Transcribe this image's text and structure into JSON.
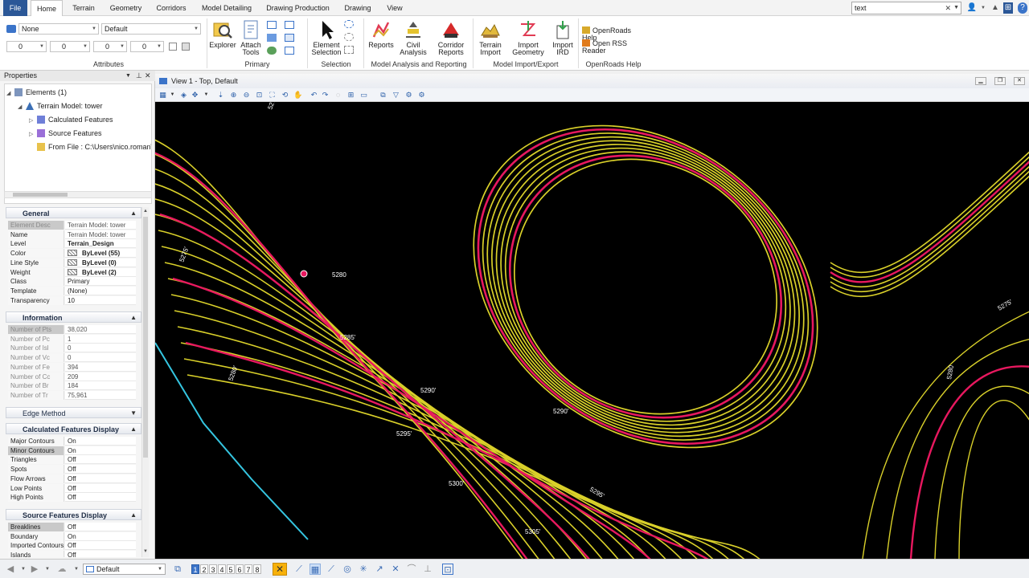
{
  "ribbon": {
    "tabs": [
      "File",
      "Home",
      "Terrain",
      "Geometry",
      "Corridors",
      "Model Detailing",
      "Drawing Production",
      "Drawing",
      "View"
    ],
    "active_tab": "Home",
    "search_value": "text",
    "attributes": {
      "level": "None",
      "style": "Default",
      "weight_a": "0",
      "weight_b": "0",
      "weight_c": "0",
      "weight_d": "0",
      "group_label": "Attributes"
    },
    "primary": {
      "explorer": "Explorer",
      "attach_tools": [
        "Attach",
        "Tools"
      ],
      "group_label": "Primary"
    },
    "selection": {
      "element_selection": [
        "Element",
        "Selection"
      ],
      "group_label": "Selection"
    },
    "analysis": {
      "reports": "Reports",
      "civil_analysis": [
        "Civil",
        "Analysis"
      ],
      "corridor_reports": [
        "Corridor",
        "Reports"
      ],
      "group_label": "Model Analysis and Reporting"
    },
    "import_export": {
      "terrain_import": [
        "Terrain",
        "Import"
      ],
      "import_geometry": [
        "Import",
        "Geometry"
      ],
      "import_ird": [
        "Import",
        "IRD"
      ],
      "group_label": "Model Import/Export"
    },
    "help": {
      "openroads_help": "OpenRoads Help",
      "rss": "Open RSS Reader",
      "group_label": "OpenRoads Help"
    }
  },
  "properties_panel": {
    "title": "Properties",
    "tree": {
      "elements": "Elements (1)",
      "terrain_model": "Terrain Model: tower",
      "calculated": "Calculated Features",
      "source": "Source Features",
      "from_file": "From File : C:\\Users\\nico.roman\\"
    },
    "sections": {
      "general": "General",
      "information": "Information",
      "edge_method": "Edge Method",
      "calc_display": "Calculated Features Display",
      "source_display": "Source Features Display"
    },
    "general_rows": [
      {
        "k": "Element Desc",
        "v": "Terrain Model: tower"
      },
      {
        "k": "Name",
        "v": "Terrain Model: tower"
      },
      {
        "k": "Level",
        "v": "Terrain_Design"
      },
      {
        "k": "Color",
        "v": "ByLevel (55)"
      },
      {
        "k": "Line Style",
        "v": "ByLevel (0)"
      },
      {
        "k": "Weight",
        "v": "ByLevel (2)"
      },
      {
        "k": "Class",
        "v": "Primary"
      },
      {
        "k": "Template",
        "v": "(None)"
      },
      {
        "k": "Transparency",
        "v": "10"
      }
    ],
    "information_rows": [
      {
        "k": "Number of Pts",
        "v": "38,020"
      },
      {
        "k": "Number of Pc",
        "v": "1"
      },
      {
        "k": "Number of Isl",
        "v": "0"
      },
      {
        "k": "Number of Vc",
        "v": "0"
      },
      {
        "k": "Number of Fe",
        "v": "394"
      },
      {
        "k": "Number of Cc",
        "v": "209"
      },
      {
        "k": "Number of Br",
        "v": "184"
      },
      {
        "k": "Number of Tr",
        "v": "75,961"
      }
    ],
    "calc_rows": [
      {
        "k": "Major Contours",
        "v": "On"
      },
      {
        "k": "Minor Contours",
        "v": "On"
      },
      {
        "k": "Triangles",
        "v": "Off"
      },
      {
        "k": "Spots",
        "v": "Off"
      },
      {
        "k": "Flow Arrows",
        "v": "Off"
      },
      {
        "k": "Low Points",
        "v": "Off"
      },
      {
        "k": "High Points",
        "v": "Off"
      }
    ],
    "source_rows": [
      {
        "k": "Breaklines",
        "v": "Off"
      },
      {
        "k": "Boundary",
        "v": "On"
      },
      {
        "k": "Imported Contours",
        "v": "Off"
      },
      {
        "k": "Islands",
        "v": "Off"
      }
    ]
  },
  "view": {
    "title": "View 1 - Top, Default",
    "contour_labels": [
      "5275'",
      "5280",
      "5285'",
      "5290'",
      "5290'",
      "5295'",
      "5300'",
      "5305'",
      "5280'",
      "5275'",
      "5280",
      "5275'",
      "5295'",
      "5285'"
    ],
    "colors": {
      "major": "#e8185f",
      "minor": "#d9d02a",
      "boundary": "#35c5e0",
      "background": "#000000"
    }
  },
  "statusbar": {
    "view_combo": "Default",
    "view_numbers": [
      "1",
      "2",
      "3",
      "4",
      "5",
      "6",
      "7",
      "8"
    ],
    "selected_view": "1"
  }
}
